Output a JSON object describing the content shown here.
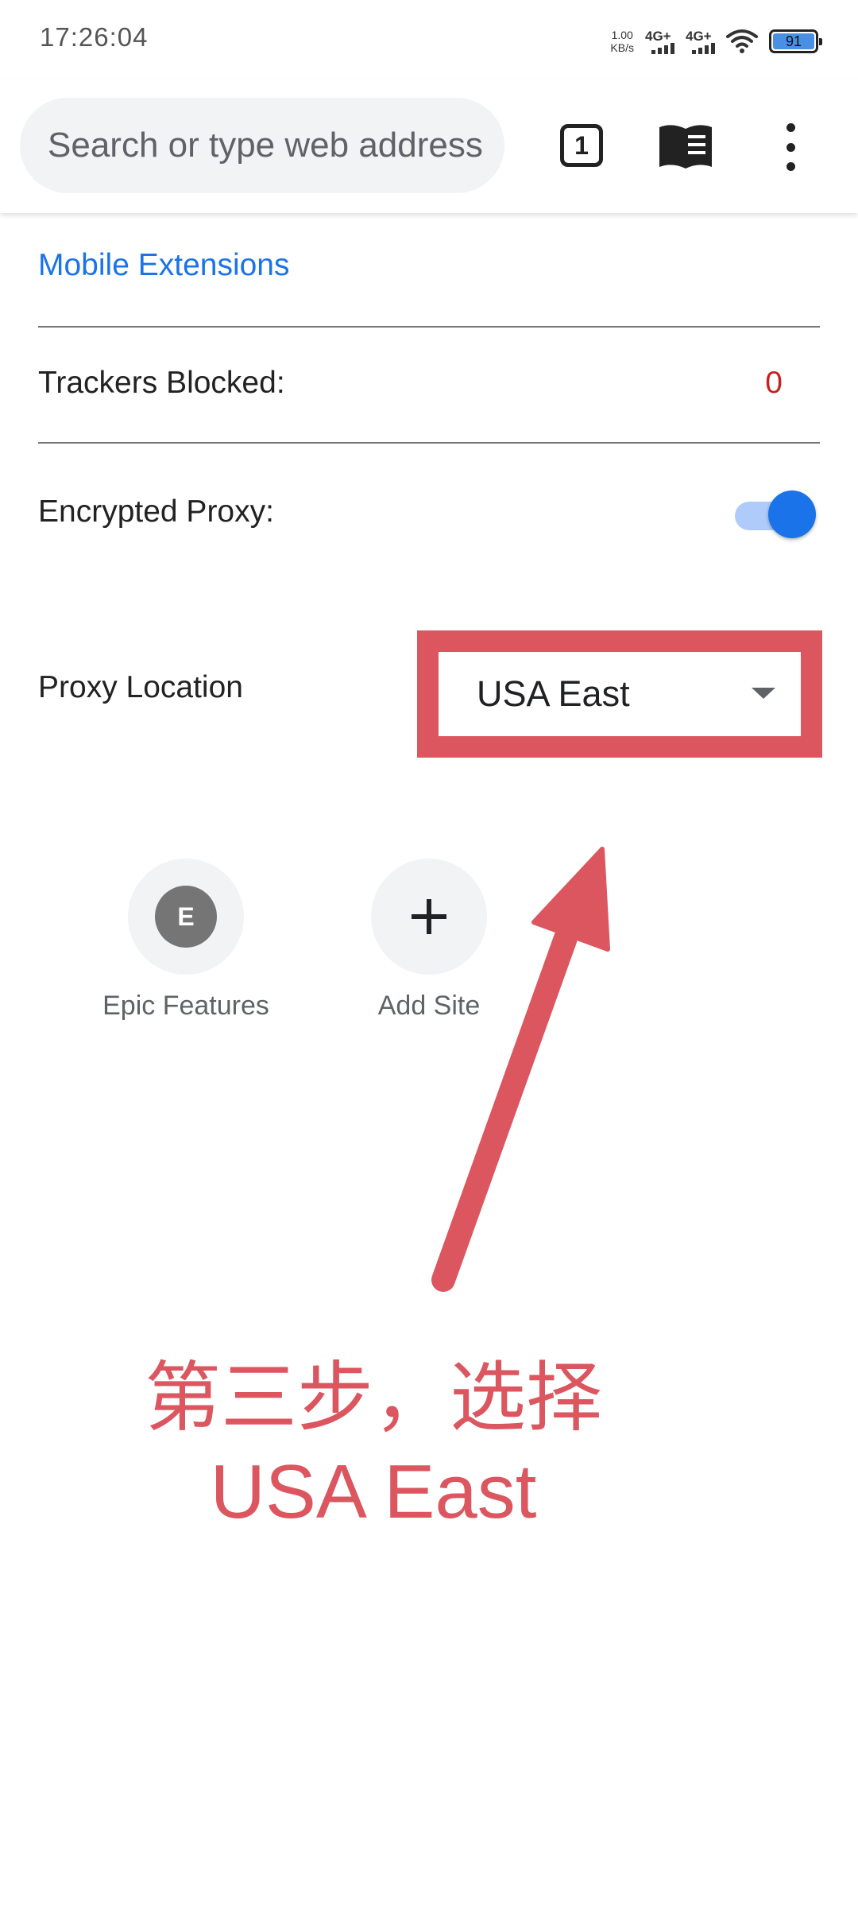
{
  "status_bar": {
    "time": "17:26:04",
    "net_speed_value": "1.00",
    "net_speed_unit": "KB/s",
    "signal1_label": "4G+",
    "signal2_label": "4G+",
    "battery_level": "91",
    "icons": [
      "signal-icon",
      "signal-icon",
      "wifi-icon",
      "battery-icon"
    ]
  },
  "toolbar": {
    "search_placeholder": "Search or type web address",
    "tab_count": "1",
    "icons": [
      "tab-switcher-icon",
      "reader-mode-icon",
      "more-menu-icon"
    ]
  },
  "content": {
    "extensions_link": "Mobile Extensions",
    "trackers_label": "Trackers Blocked:",
    "trackers_value": "0",
    "proxy_label": "Encrypted Proxy:",
    "proxy_enabled": true,
    "location_label": "Proxy Location",
    "location_value": "USA East"
  },
  "shortcuts": [
    {
      "letter": "E",
      "label": "Epic Features",
      "icon": "letter-avatar-icon"
    },
    {
      "label": "Add Site",
      "icon": "plus-icon"
    }
  ],
  "annotation": {
    "line1": "第三步，选择",
    "line2": "USA East"
  },
  "colors": {
    "accent": "#1a73e8",
    "annotation_red": "#dc5660",
    "tracker_red": "#c5221f"
  }
}
